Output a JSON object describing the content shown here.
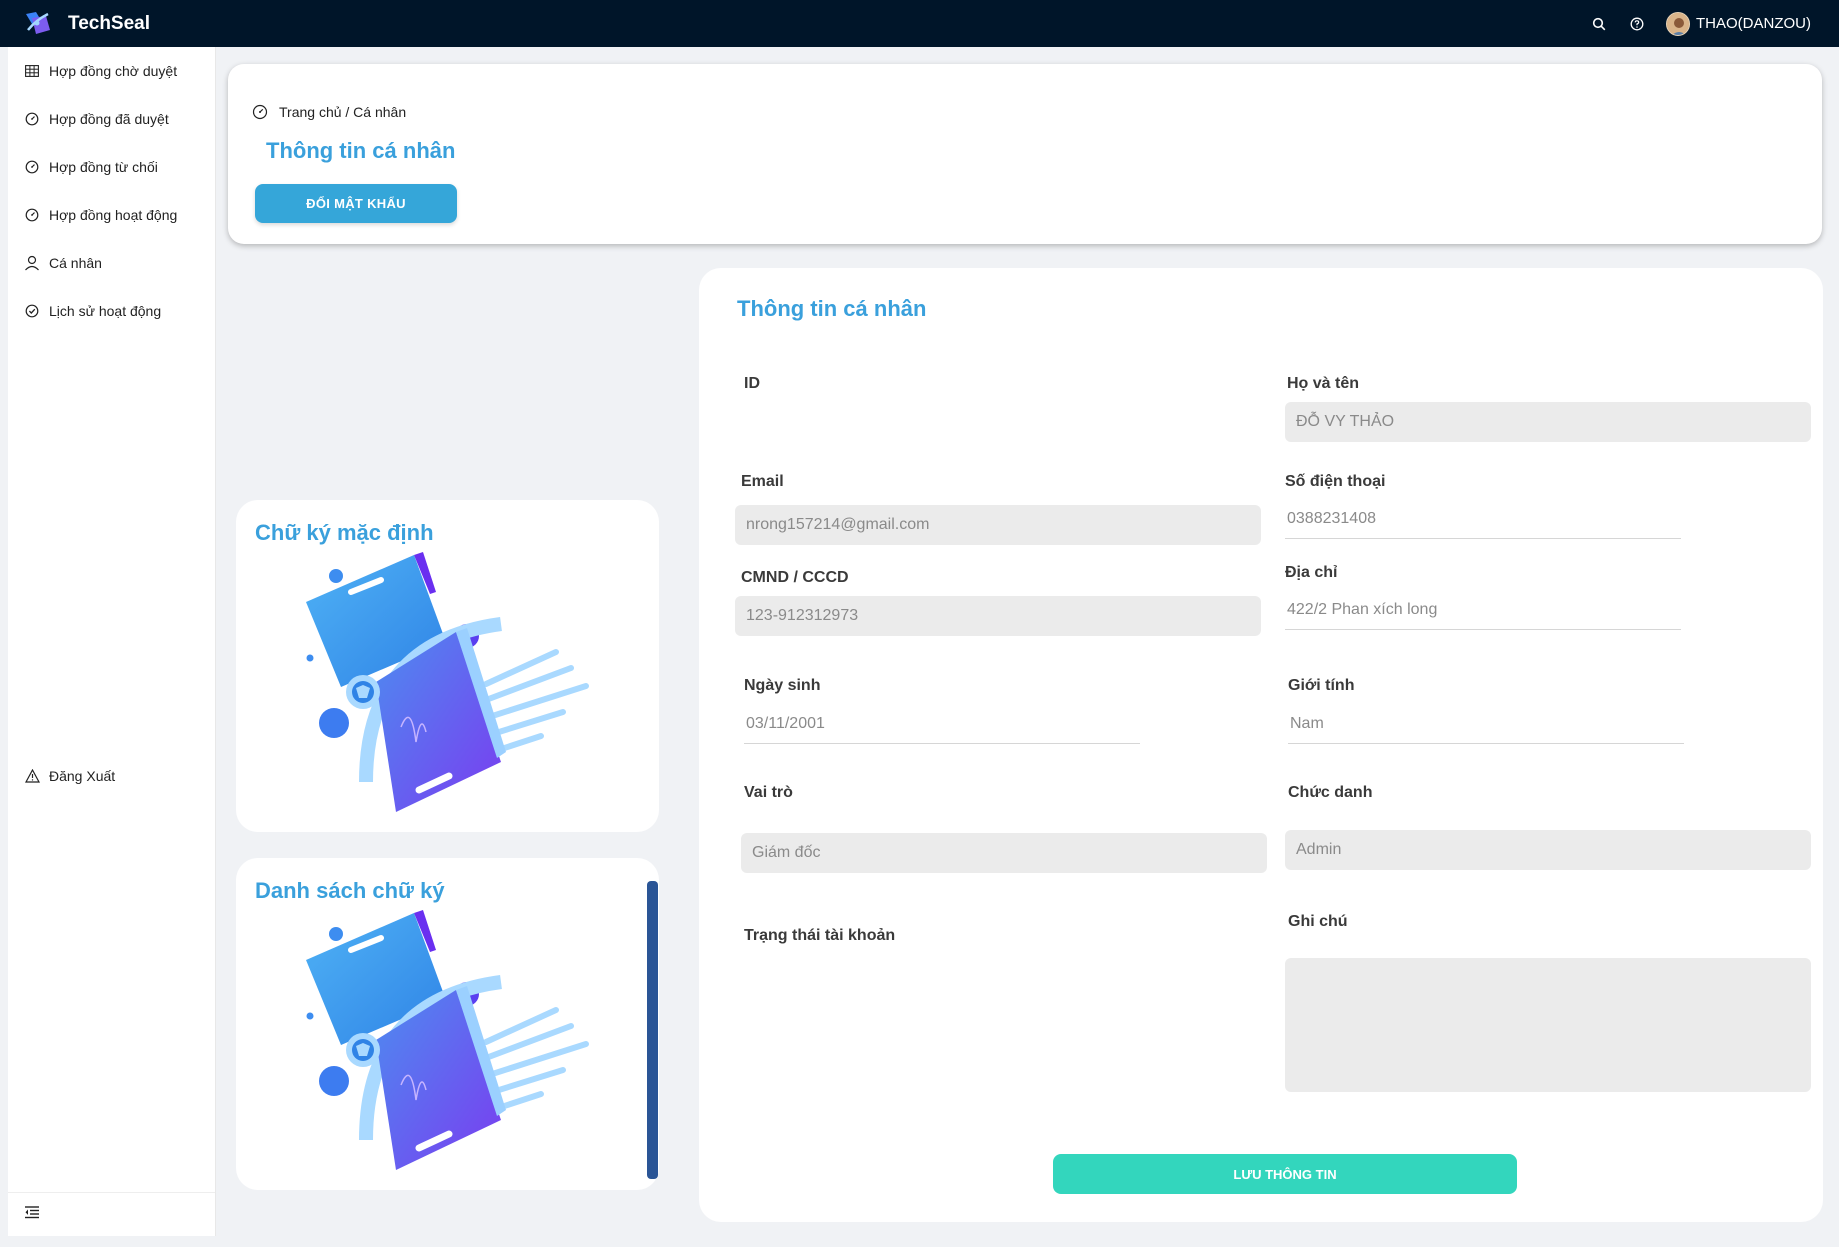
{
  "app": {
    "name": "TechSeal"
  },
  "header": {
    "user_name": "THAO(DANZOU)",
    "icons": [
      "search-icon",
      "help-icon"
    ]
  },
  "sidebar": {
    "items": [
      {
        "label": "Hợp đồng chờ duyệt",
        "icon": "table-icon"
      },
      {
        "label": "Hợp đồng đã duyệt",
        "icon": "dashboard-icon"
      },
      {
        "label": "Hợp đồng từ chối",
        "icon": "dashboard-icon"
      },
      {
        "label": "Hợp đồng hoạt động",
        "icon": "dashboard-icon"
      },
      {
        "label": "Cá nhân",
        "icon": "user-icon"
      },
      {
        "label": "Lịch sử hoạt động",
        "icon": "check-circle-icon"
      }
    ],
    "logout_label": "Đăng Xuất"
  },
  "page": {
    "breadcrumb": "Trang chủ / Cá nhân",
    "title": "Thông tin cá nhân",
    "change_password_label": "ĐỔI MẬT KHẨU"
  },
  "signature": {
    "default_title": "Chữ ký mặc định",
    "list_title": "Danh sách chữ ký"
  },
  "profile": {
    "title": "Thông tin cá nhân",
    "fields": {
      "id": {
        "label": "ID",
        "value": ""
      },
      "full_name": {
        "label": "Họ và tên",
        "value": "ĐỖ VY THẢO"
      },
      "email": {
        "label": "Email",
        "value": "nrong157214@gmail.com"
      },
      "phone": {
        "label": "Số điện thoại",
        "value": "0388231408"
      },
      "id_card": {
        "label": "CMND / CCCD",
        "value": "123-912312973"
      },
      "address": {
        "label": "Địa chỉ",
        "value": "422/2 Phan xích long"
      },
      "birthday": {
        "label": "Ngày sinh",
        "value": "03/11/2001"
      },
      "gender": {
        "label": "Giới tính",
        "value": "Nam"
      },
      "role": {
        "label": "Vai trò",
        "value": "Giám đốc"
      },
      "position": {
        "label": "Chức danh",
        "value": "Admin"
      },
      "status": {
        "label": "Trạng thái tài khoản",
        "value": ""
      },
      "note": {
        "label": "Ghi chú",
        "value": ""
      }
    },
    "save_label": "LƯU THÔNG TIN"
  },
  "colors": {
    "header_bg": "#001529",
    "title_blue": "#3aa0dc",
    "primary_button": "#35a6d9",
    "save_button": "#33d6bd"
  }
}
